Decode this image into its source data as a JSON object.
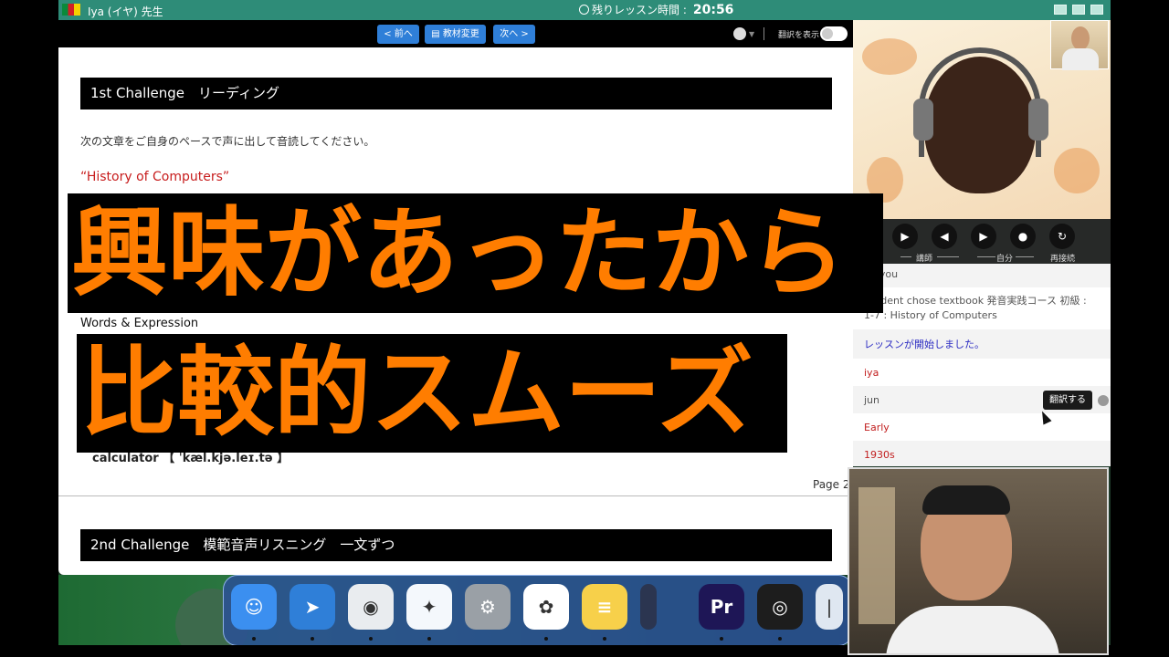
{
  "titlebar": {
    "teacher_name": "Iya (イヤ) 先生",
    "timer_label": "残りレッスン時間 :",
    "timer_value": "20:56"
  },
  "toolbar": {
    "prev_label": "< 前へ",
    "material_label": "教材変更",
    "next_label": "次へ >",
    "translate_label": "翻訳を表示"
  },
  "content": {
    "section1_title": "1st Challenge　リーディング",
    "instruction": "次の文章をご自身のペースで声に出して音読してください。",
    "story_title": "“History of Computers”",
    "words_heading": "Words & Expression",
    "vocab_item": "calculator 【 ˈkæl.kjə.leɪ.tə 】",
    "page_label": "Page 2",
    "section2_title": "2nd Challenge　模範音声リスニング　一文ずつ"
  },
  "captions": {
    "line1": "興味があったから",
    "line2": "比較的スムーズ"
  },
  "controls": {
    "teacher_label": "講師",
    "self_label": "自分",
    "reconnect_label": "再接続"
  },
  "chat": {
    "messages": [
      {
        "text": "nk you",
        "style": "gray"
      },
      {
        "text": "Student chose textbook 発音実践コース 初級 : 1-7 : History of Computers",
        "style": "gray"
      },
      {
        "text": "レッスンが開始しました。",
        "style": "blue"
      },
      {
        "text": "iya",
        "style": "red"
      },
      {
        "text": "jun",
        "style": "gray"
      },
      {
        "text": "Early",
        "style": "red"
      },
      {
        "text": "1930s",
        "style": "red"
      }
    ],
    "tooltip": "翻訳する"
  },
  "dock": {
    "apps": [
      {
        "name": "Finder",
        "icon": "finder-icon",
        "color": "#3b8ff0"
      },
      {
        "name": "Spark",
        "icon": "spark-icon",
        "color": "#2f7fd8"
      },
      {
        "name": "Chrome",
        "icon": "chrome-icon",
        "color": "#e9ecef"
      },
      {
        "name": "Safari",
        "icon": "safari-icon",
        "color": "#f4f8fc"
      },
      {
        "name": "System Settings",
        "icon": "settings-icon",
        "color": "#9aa0a6"
      },
      {
        "name": "Photos",
        "icon": "photos-icon",
        "color": "#ffffff"
      },
      {
        "name": "Notes",
        "icon": "notes-icon",
        "color": "#f7d04a"
      },
      {
        "name": "Audio Meter",
        "icon": "meter-icon",
        "color": "#2b3550"
      },
      {
        "name": "Premiere Pro",
        "icon": "premiere-icon",
        "color": "#1e1656",
        "text": "Pr"
      },
      {
        "name": "OBS",
        "icon": "obs-icon",
        "color": "#1d1d1d"
      },
      {
        "name": "1Password",
        "icon": "onepassword-icon",
        "color": "#dfe7f1"
      }
    ]
  },
  "colors": {
    "titlebar": "#2e8c78",
    "button_blue": "#2f7fd8",
    "caption_orange": "#ff7d00",
    "story_red": "#c71c1c"
  }
}
